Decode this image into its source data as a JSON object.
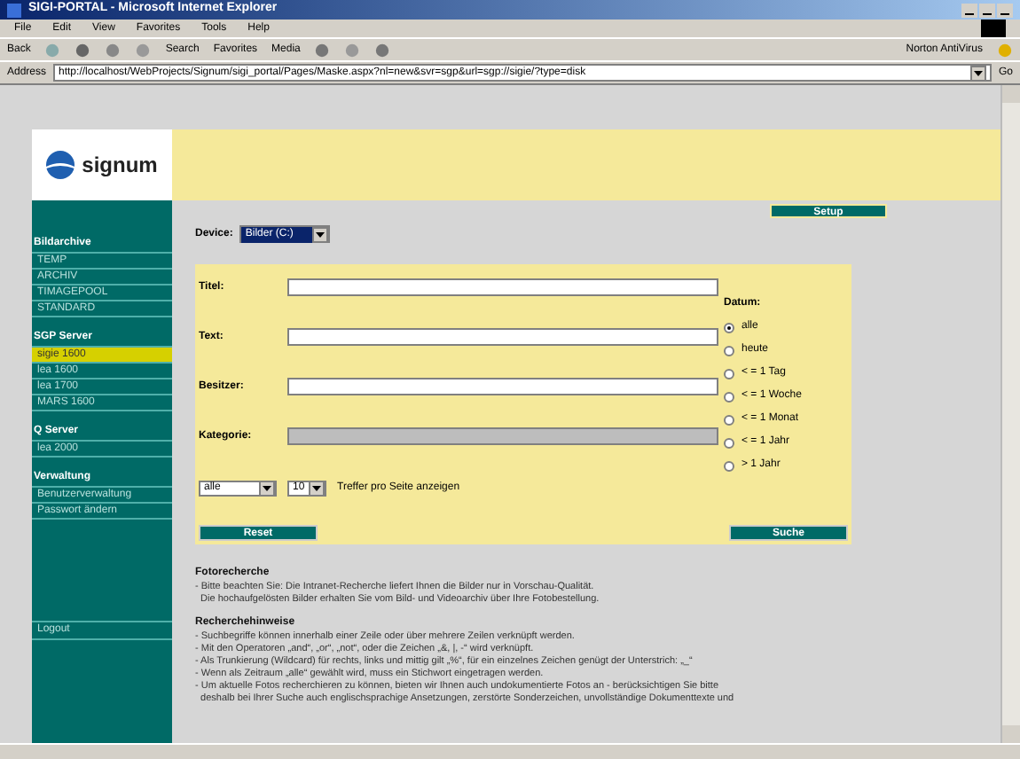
{
  "window": {
    "title": "SIGI-PORTAL - Microsoft Internet Explorer"
  },
  "menu": [
    "File",
    "Edit",
    "View",
    "Favorites",
    "Tools",
    "Help"
  ],
  "toolbar": {
    "back": "Back",
    "search": "Search",
    "favorites": "Favorites",
    "media": "Media",
    "norton": "Norton AntiVirus"
  },
  "address": {
    "label": "Address",
    "url": "http://localhost/WebProjects/Signum/sigi_portal/Pages/Maske.aspx?nl=new&svr=sgp&url=sgp://sigie/?type=disk",
    "go": "Go"
  },
  "logo": {
    "text": "signum"
  },
  "sidebar": [
    {
      "title": "Bildarchive",
      "items": [
        {
          "label": "TEMP",
          "selected": false
        },
        {
          "label": "ARCHIV",
          "selected": false
        },
        {
          "label": "TIMAGEPOOL",
          "selected": false
        },
        {
          "label": "STANDARD",
          "selected": false
        }
      ]
    },
    {
      "title": "SGP Server",
      "items": [
        {
          "label": "sigie 1600",
          "selected": true
        },
        {
          "label": "lea 1600",
          "selected": false
        },
        {
          "label": "lea 1700",
          "selected": false
        },
        {
          "label": "MARS 1600",
          "selected": false
        }
      ]
    },
    {
      "title": "Q Server",
      "items": [
        {
          "label": "lea 2000",
          "selected": false
        }
      ]
    },
    {
      "title": "Verwaltung",
      "items": [
        {
          "label": "Benutzerverwaltung",
          "selected": false
        },
        {
          "label": "Passwort ändern",
          "selected": false
        }
      ]
    }
  ],
  "logout": "Logout",
  "setup": "Setup",
  "device": {
    "label": "Device:",
    "value": "Bilder (C:)"
  },
  "fields": [
    {
      "label": "Titel:",
      "disabled": false
    },
    {
      "label": "Text:",
      "disabled": false
    },
    {
      "label": "Besitzer:",
      "disabled": false
    },
    {
      "label": "Kategorie:",
      "disabled": true
    }
  ],
  "datum": {
    "label": "Datum:",
    "options": [
      {
        "label": "alle",
        "selected": true
      },
      {
        "label": "heute",
        "selected": false
      },
      {
        "label": "< = 1 Tag",
        "selected": false
      },
      {
        "label": "< = 1 Woche",
        "selected": false
      },
      {
        "label": "< = 1 Monat",
        "selected": false
      },
      {
        "label": "< = 1 Jahr",
        "selected": false
      },
      {
        "label": "> 1 Jahr",
        "selected": false
      }
    ]
  },
  "scope_select": "alle",
  "count_select": "10",
  "count_label": "Treffer pro Seite anzeigen",
  "reset": "Reset",
  "search": "Suche",
  "info": [
    {
      "title": "Fotorecherche",
      "lines": [
        "- Bitte beachten Sie: Die Intranet-Recherche liefert Ihnen die Bilder nur in Vorschau-Qualität.",
        "  Die hochaufgelösten Bilder erhalten Sie vom Bild- und Videoarchiv über Ihre Fotobestellung."
      ]
    },
    {
      "title": "Recherchehinweise",
      "lines": [
        "- Suchbegriffe können innerhalb einer Zeile oder über mehrere Zeilen verknüpft werden.",
        "- Mit den Operatoren „and“, „or“, „not“, oder die Zeichen „&, |, -“ wird verknüpft.",
        "- Als Trunkierung (Wildcard) für rechts, links und mittig gilt „%“, für ein einzelnes Zeichen genügt der Unterstrich: „_“",
        "- Wenn als Zeitraum „alle“ gewählt wird, muss ein Stichwort eingetragen werden.",
        "- Um aktuelle Fotos recherchieren zu können, bieten wir Ihnen auch undokumentierte Fotos an - berücksichtigen Sie bitte",
        "  deshalb bei Ihrer Suche auch englischsprachige Ansetzungen, zerstörte Sonderzeichen, unvollständige Dokumenttexte und"
      ]
    }
  ]
}
